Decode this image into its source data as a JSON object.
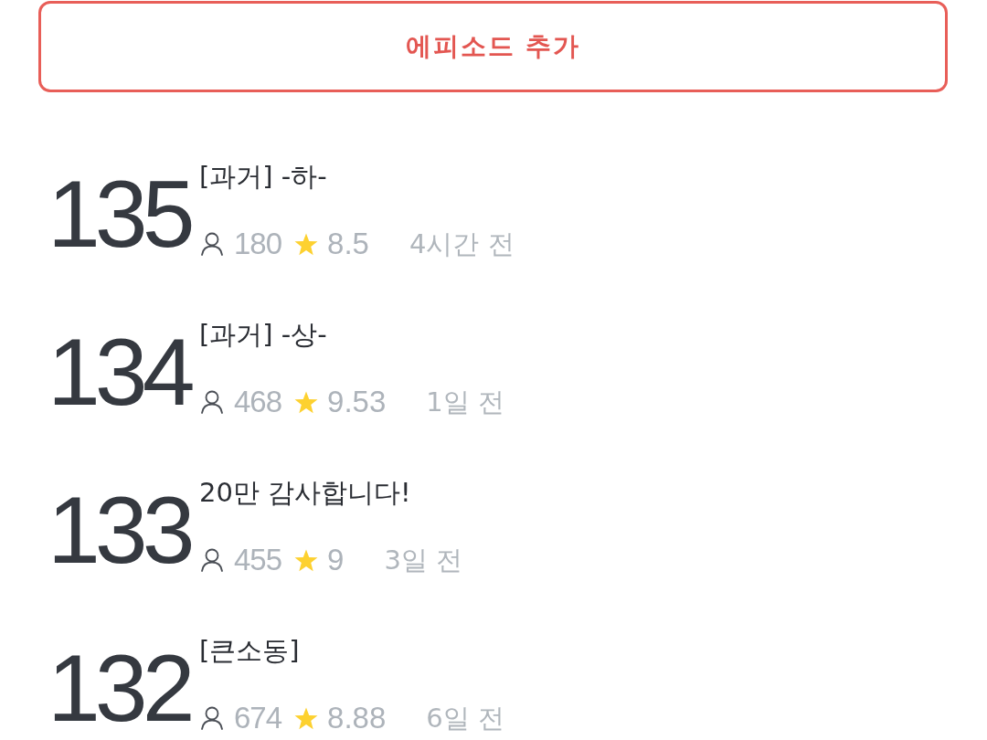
{
  "add_episode_button": {
    "label": "에피소드 추가"
  },
  "episodes": [
    {
      "number": "135",
      "title": "[과거] -하-",
      "views": "180",
      "rating": "8.5",
      "time": "4시간 전"
    },
    {
      "number": "134",
      "title": "[과거] -상-",
      "views": "468",
      "rating": "9.53",
      "time": "1일 전"
    },
    {
      "number": "133",
      "title": "20만 감사합니다!",
      "views": "455",
      "rating": "9",
      "time": "3일 전"
    },
    {
      "number": "132",
      "title": "[큰소동]",
      "views": "674",
      "rating": "8.88",
      "time": "6일 전"
    }
  ]
}
